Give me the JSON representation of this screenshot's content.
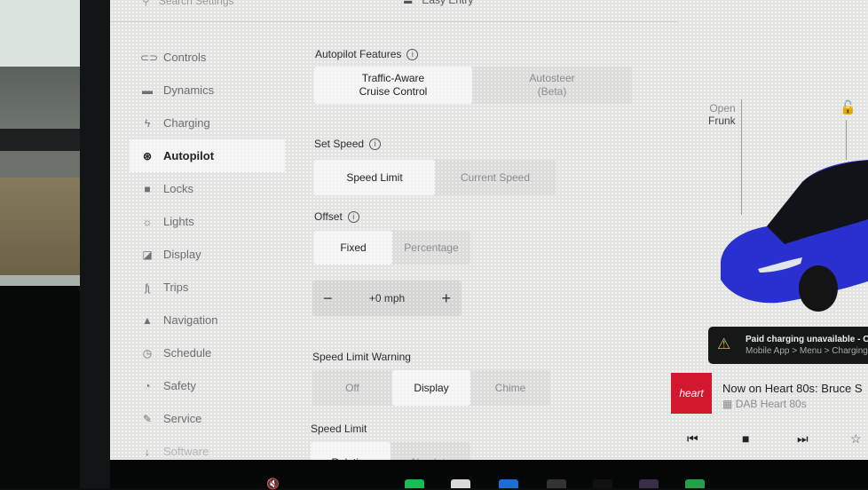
{
  "topbar": {
    "search_placeholder": "Search Settings",
    "easy_entry": "Easy Entry"
  },
  "sidebar": {
    "items": [
      {
        "label": "Controls",
        "icon": "toggle-icon",
        "glyph": "⊂⊃"
      },
      {
        "label": "Dynamics",
        "icon": "car-icon",
        "glyph": "🚘"
      },
      {
        "label": "Charging",
        "icon": "lightning-icon",
        "glyph": "ϟ"
      },
      {
        "label": "Autopilot",
        "icon": "steering-wheel-icon",
        "glyph": "⊛",
        "active": true
      },
      {
        "label": "Locks",
        "icon": "lock-icon",
        "glyph": "🔒"
      },
      {
        "label": "Lights",
        "icon": "sun-icon",
        "glyph": "☼"
      },
      {
        "label": "Display",
        "icon": "display-icon",
        "glyph": "◪"
      },
      {
        "label": "Trips",
        "icon": "trips-icon",
        "glyph": "ᥰ"
      },
      {
        "label": "Navigation",
        "icon": "navigation-icon",
        "glyph": "▲"
      },
      {
        "label": "Schedule",
        "icon": "alarm-clock-icon",
        "glyph": "◷"
      },
      {
        "label": "Safety",
        "icon": "safety-icon",
        "glyph": "◔"
      },
      {
        "label": "Service",
        "icon": "wrench-icon",
        "glyph": "🔧"
      },
      {
        "label": "Software",
        "icon": "download-icon",
        "glyph": "↓"
      }
    ]
  },
  "autopilot": {
    "features": {
      "title": "Autopilot Features",
      "options": [
        "Traffic-Aware\nCruise Control",
        "Autosteer\n(Beta)"
      ],
      "selected": "Traffic-Aware Cruise Control"
    },
    "set_speed": {
      "title": "Set Speed",
      "options": [
        "Speed Limit",
        "Current Speed"
      ],
      "selected": "Speed Limit"
    },
    "offset": {
      "title": "Offset",
      "options": [
        "Fixed",
        "Percentage"
      ],
      "selected": "Fixed",
      "value": "+0 mph",
      "minus": "−",
      "plus": "+"
    },
    "speed_limit_warning": {
      "title": "Speed Limit Warning",
      "options": [
        "Off",
        "Display",
        "Chime"
      ],
      "selected": "Display"
    },
    "speed_limit": {
      "title": "Speed Limit",
      "options": [
        "Relative",
        "Absolute"
      ],
      "selected": "Relative"
    }
  },
  "vehicle": {
    "frunk_line1": "Open",
    "frunk_line2": "Frunk",
    "lock_icon": "unlock-icon",
    "car_color": "#2a2fd0"
  },
  "notification": {
    "title": "Paid charging unavailable - Ch",
    "subtitle": "Mobile App > Menu > Charging"
  },
  "media": {
    "logo": "heart",
    "now_playing": "Now on Heart 80s: Bruce S",
    "station": "DAB Heart  80s",
    "accent": "#d2172e"
  }
}
